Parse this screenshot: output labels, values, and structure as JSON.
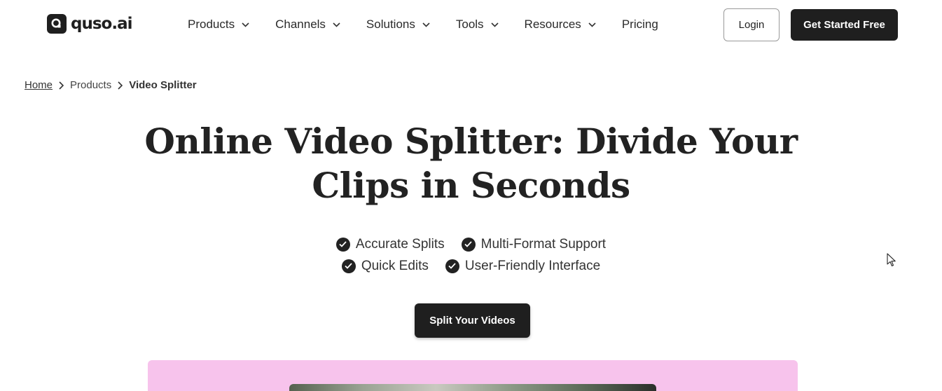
{
  "header": {
    "logo_text": "quso.ai",
    "nav": [
      {
        "label": "Products",
        "has_dropdown": true
      },
      {
        "label": "Channels",
        "has_dropdown": true
      },
      {
        "label": "Solutions",
        "has_dropdown": true
      },
      {
        "label": "Tools",
        "has_dropdown": true
      },
      {
        "label": "Resources",
        "has_dropdown": true
      },
      {
        "label": "Pricing",
        "has_dropdown": false
      }
    ],
    "login_label": "Login",
    "cta_label": "Get Started Free"
  },
  "breadcrumb": {
    "home": "Home",
    "section": "Products",
    "current": "Video Splitter"
  },
  "hero": {
    "title_line1": "Online Video Splitter: Divide Your",
    "title_line2": "Clips in Seconds",
    "features": [
      "Accurate Splits",
      "Multi-Format Support",
      "Quick Edits",
      "User-Friendly Interface"
    ],
    "cta_label": "Split Your Videos"
  },
  "colors": {
    "primary_dark": "#1f1f1f",
    "preview_bg": "#f7c3ec",
    "text": "#222222"
  },
  "icons": {
    "logo": "quso-logo-icon",
    "dropdown": "chevron-down-icon",
    "breadcrumb_sep": "chevron-right-icon",
    "feature": "check-circle-icon",
    "cursor": "mouse-pointer-icon"
  }
}
